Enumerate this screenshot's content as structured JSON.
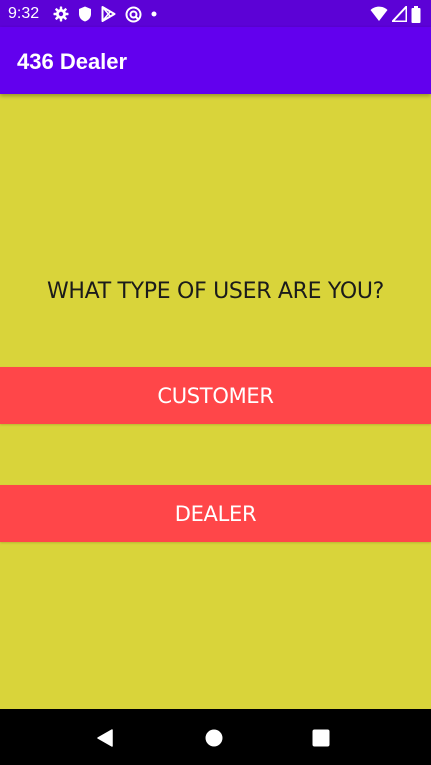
{
  "status_bar": {
    "time": "9:32",
    "left_icons": [
      "settings-icon",
      "shield-icon",
      "play-store-icon",
      "vpn-icon",
      "dot-icon"
    ],
    "right_icons": [
      "wifi-icon",
      "signal-icon",
      "battery-icon"
    ]
  },
  "app_bar": {
    "title": "436 Dealer"
  },
  "main": {
    "question": "WHAT TYPE OF USER ARE YOU?",
    "customer_label": "CUSTOMER",
    "dealer_label": "DEALER"
  },
  "nav_bar": {
    "icons": [
      "back-icon",
      "home-icon",
      "recents-icon"
    ]
  },
  "colors": {
    "status_bar": "#5c02d6",
    "app_bar": "#6200ee",
    "background": "#d9d43a",
    "button": "#ff4649",
    "nav_bar": "#000000"
  }
}
